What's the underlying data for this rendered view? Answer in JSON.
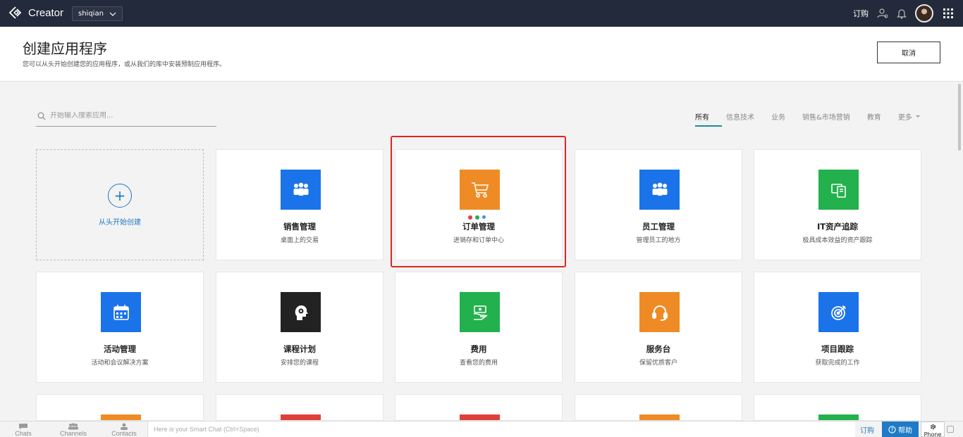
{
  "topbar": {
    "app_name": "Creator",
    "org_name": "shiqian",
    "subscribe_label": "订购"
  },
  "header": {
    "title": "创建应用程序",
    "subtitle": "您可以从头开始创建您的应用程序，或从我们的库中安装预制应用程序。",
    "cancel_label": "取消"
  },
  "search": {
    "placeholder": "开始输入搜索应用..."
  },
  "categories": [
    {
      "label": "所有",
      "active": true
    },
    {
      "label": "信息技术",
      "active": false
    },
    {
      "label": "业务",
      "active": false
    },
    {
      "label": "销售&市场营销",
      "active": false
    },
    {
      "label": "教育",
      "active": false
    },
    {
      "label": "更多",
      "active": false
    }
  ],
  "new_card": {
    "label": "从头开始创建"
  },
  "apps": [
    {
      "name": "销售管理",
      "desc": "桌面上的交易",
      "color": "#1a73e8",
      "icon": "people-group-icon"
    },
    {
      "name": "订单管理",
      "desc": "进销存和订单中心",
      "color": "#ef8b24",
      "icon": "shopping-cart-icon",
      "selected": true
    },
    {
      "name": "员工管理",
      "desc": "管理员工的地方",
      "color": "#1a73e8",
      "icon": "people-group-icon"
    },
    {
      "name": "IT资产追踪",
      "desc": "极具成本效益的资产跟踪",
      "color": "#22b14c",
      "icon": "devices-icon"
    },
    {
      "name": "活动管理",
      "desc": "活动和会议解决方案",
      "color": "#1a73e8",
      "icon": "calendar-icon"
    },
    {
      "name": "课程计划",
      "desc": "安排您的课程",
      "color": "#222222",
      "icon": "head-gear-icon"
    },
    {
      "name": "费用",
      "desc": "查看您的费用",
      "color": "#22b14c",
      "icon": "money-hand-icon"
    },
    {
      "name": "服务台",
      "desc": "保留优质客户",
      "color": "#ef8b24",
      "icon": "headset-icon"
    },
    {
      "name": "项目跟踪",
      "desc": "获取完成的工作",
      "color": "#1a73e8",
      "icon": "target-icon"
    }
  ],
  "partial_row_colors": [
    "#ef8b24",
    "#e0403a",
    "#e0403a",
    "#ef8b24",
    "#22b14c"
  ],
  "bottombar": {
    "chats": "Chats",
    "channels": "Channels",
    "contacts": "Contacts",
    "smart_chat_placeholder": "Here is your Smart Chat (Ctrl+Space)",
    "subscribe": "订购",
    "help": "帮助",
    "phone": "Phone"
  }
}
